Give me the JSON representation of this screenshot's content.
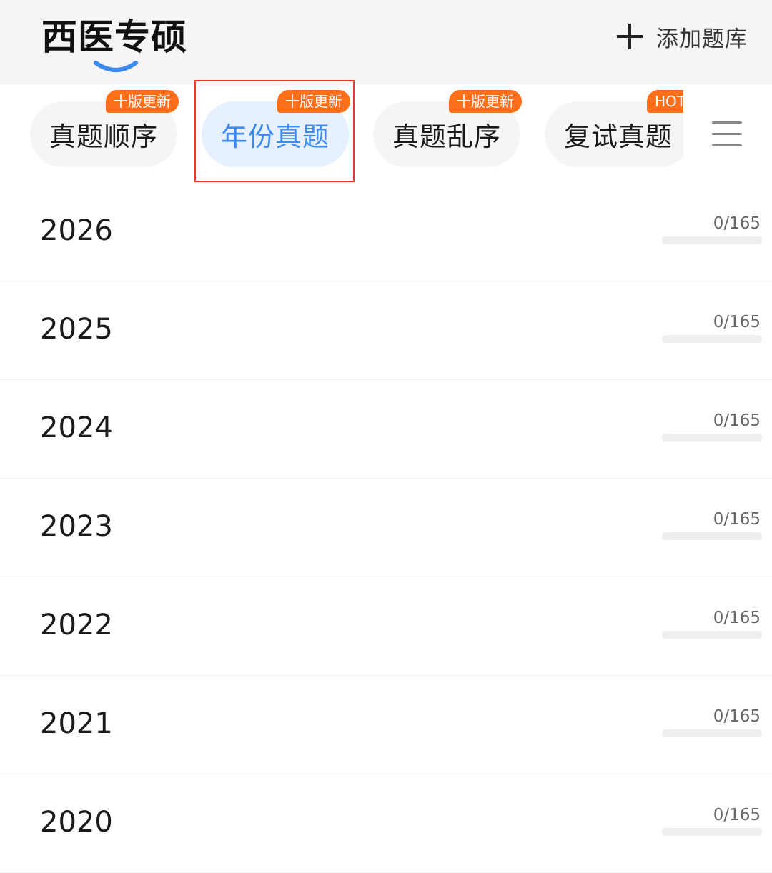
{
  "header": {
    "title": "西医专硕",
    "add_bank_label": "添加题库",
    "accent_color": "#3d8bf0"
  },
  "tabs": [
    {
      "label": "真题顺序",
      "badge": "十版更新",
      "active": false
    },
    {
      "label": "年份真题",
      "badge": "十版更新",
      "active": true
    },
    {
      "label": "真题乱序",
      "badge": "十版更新",
      "active": false
    },
    {
      "label": "复试真题",
      "badge": "HOT",
      "active": false
    }
  ],
  "years": [
    {
      "year": "2026",
      "progress_text": "0/165",
      "progress_fraction": 0
    },
    {
      "year": "2025",
      "progress_text": "0/165",
      "progress_fraction": 0
    },
    {
      "year": "2024",
      "progress_text": "0/165",
      "progress_fraction": 0
    },
    {
      "year": "2023",
      "progress_text": "0/165",
      "progress_fraction": 0
    },
    {
      "year": "2022",
      "progress_text": "0/165",
      "progress_fraction": 0
    },
    {
      "year": "2021",
      "progress_text": "0/165",
      "progress_fraction": 0
    },
    {
      "year": "2020",
      "progress_text": "0/165",
      "progress_fraction": 0
    }
  ]
}
